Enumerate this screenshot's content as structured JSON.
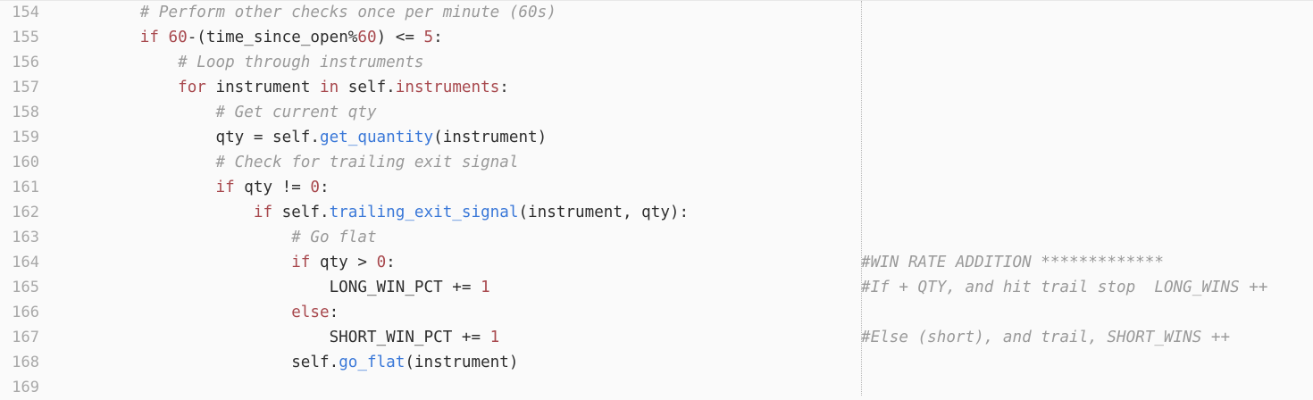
{
  "lines": [
    {
      "n": "154",
      "tokens": [
        [
          "cm",
          "        # Perform other checks once per minute (60s)"
        ]
      ],
      "right": ""
    },
    {
      "n": "155",
      "tokens": [
        [
          "kw",
          "        if "
        ],
        [
          "num",
          "60"
        ],
        [
          "tx",
          "-(time_since_open%"
        ],
        [
          "num",
          "60"
        ],
        [
          "tx",
          ") <= "
        ],
        [
          "num",
          "5"
        ],
        [
          "tx",
          ":"
        ]
      ],
      "right": ""
    },
    {
      "n": "156",
      "tokens": [
        [
          "cm",
          "            # Loop through instruments"
        ]
      ],
      "right": ""
    },
    {
      "n": "157",
      "tokens": [
        [
          "kw",
          "            for "
        ],
        [
          "tx",
          "instrument "
        ],
        [
          "kw",
          "in "
        ],
        [
          "tx",
          "self."
        ],
        [
          "attr",
          "instruments"
        ],
        [
          "tx",
          ":"
        ]
      ],
      "right": ""
    },
    {
      "n": "158",
      "tokens": [
        [
          "cm",
          "                # Get current qty"
        ]
      ],
      "right": ""
    },
    {
      "n": "159",
      "tokens": [
        [
          "tx",
          "                qty = self."
        ],
        [
          "fn",
          "get_quantity"
        ],
        [
          "tx",
          "(instrument)"
        ]
      ],
      "right": ""
    },
    {
      "n": "160",
      "tokens": [
        [
          "cm",
          "                # Check for trailing exit signal"
        ]
      ],
      "right": ""
    },
    {
      "n": "161",
      "tokens": [
        [
          "kw",
          "                if "
        ],
        [
          "tx",
          "qty != "
        ],
        [
          "num",
          "0"
        ],
        [
          "tx",
          ":"
        ]
      ],
      "right": ""
    },
    {
      "n": "162",
      "tokens": [
        [
          "kw",
          "                    if "
        ],
        [
          "tx",
          "self."
        ],
        [
          "fn",
          "trailing_exit_signal"
        ],
        [
          "tx",
          "(instrument, qty):"
        ]
      ],
      "right": ""
    },
    {
      "n": "163",
      "tokens": [
        [
          "cm",
          "                        # Go flat"
        ]
      ],
      "right": ""
    },
    {
      "n": "164",
      "tokens": [
        [
          "kw",
          "                        if "
        ],
        [
          "tx",
          "qty > "
        ],
        [
          "num",
          "0"
        ],
        [
          "tx",
          ":"
        ]
      ],
      "right": "#WIN RATE ADDITION *************"
    },
    {
      "n": "165",
      "tokens": [
        [
          "tx",
          "                            LONG_WIN_PCT += "
        ],
        [
          "num",
          "1"
        ]
      ],
      "right": "#If + QTY, and hit trail stop  LONG_WINS ++"
    },
    {
      "n": "166",
      "tokens": [
        [
          "kw",
          "                        else"
        ],
        [
          "tx",
          ":"
        ]
      ],
      "right": ""
    },
    {
      "n": "167",
      "tokens": [
        [
          "tx",
          "                            SHORT_WIN_PCT += "
        ],
        [
          "num",
          "1"
        ]
      ],
      "right": "#Else (short), and trail, SHORT_WINS ++"
    },
    {
      "n": "168",
      "tokens": [
        [
          "tx",
          "                        self."
        ],
        [
          "fn",
          "go_flat"
        ],
        [
          "tx",
          "(instrument)"
        ]
      ],
      "right": ""
    },
    {
      "n": "169",
      "tokens": [],
      "right": ""
    }
  ],
  "colors": {
    "background": "#fafafa",
    "line_number": "#a8a8a8",
    "text": "#2e2e2e",
    "comment": "#9a9a9a",
    "keyword": "#a8494e",
    "number": "#a8494e",
    "function": "#3a78d8"
  }
}
